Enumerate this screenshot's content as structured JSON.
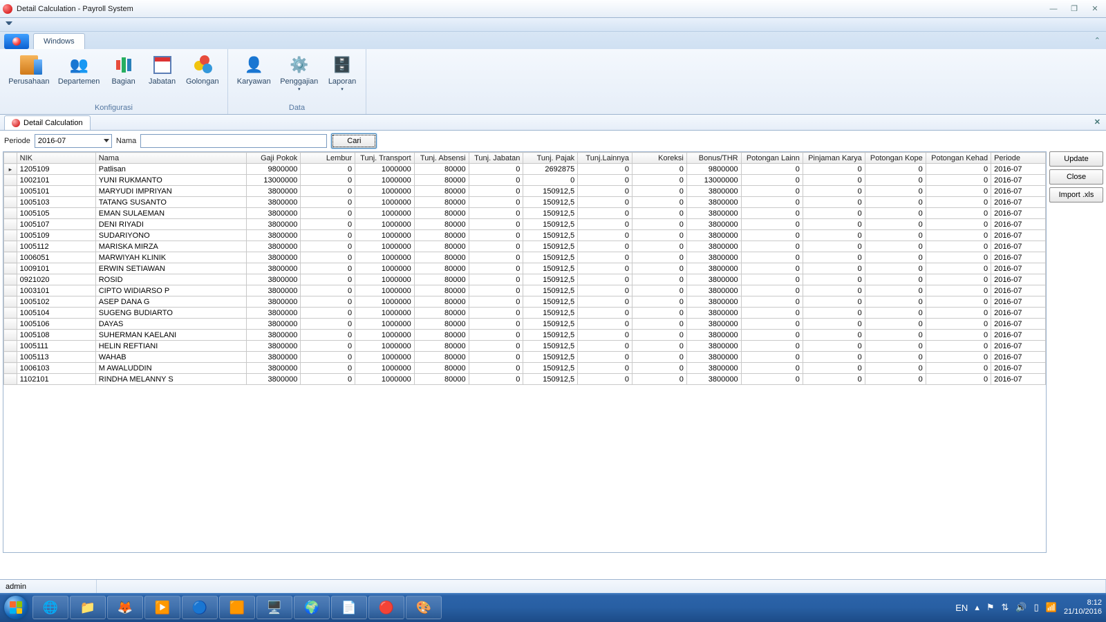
{
  "window": {
    "title": "Detail Calculation - Payroll System"
  },
  "ribbon": {
    "tab_windows": "Windows",
    "group_konfig": "Konfigurasi",
    "group_data": "Data",
    "items": {
      "perusahaan": "Perusahaan",
      "departemen": "Departemen",
      "bagian": "Bagian",
      "jabatan": "Jabatan",
      "golongan": "Golongan",
      "karyawan": "Karyawan",
      "penggajian": "Penggajian",
      "laporan": "Laporan"
    }
  },
  "doctab": {
    "label": "Detail Calculation"
  },
  "filter": {
    "periode_label": "Periode",
    "periode_value": "2016-07",
    "nama_label": "Nama",
    "nama_value": "",
    "cari": "Cari"
  },
  "buttons": {
    "update": "Update",
    "close": "Close",
    "import": "Import .xls"
  },
  "columns": [
    "",
    "NIK",
    "Nama",
    "Gaji Pokok",
    "Lembur",
    "Tunj. Transport",
    "Tunj. Absensi",
    "Tunj. Jabatan",
    "Tunj. Pajak",
    "Tunj.Lainnya",
    "Koreksi",
    "Bonus/THR",
    "Potongan Lainn",
    "Pinjaman Karya",
    "Potongan Kope",
    "Potongan Kehad",
    "Periode"
  ],
  "rows": [
    {
      "sel": true,
      "nik": "1205109",
      "nama": "Patlisan",
      "gp": "9800000",
      "lb": "0",
      "tt": "1000000",
      "ta": "80000",
      "tj": "0",
      "tp": "2692875",
      "tl": "0",
      "kr": "0",
      "bt": "9800000",
      "pl": "0",
      "pk": "0",
      "ko": "0",
      "kh": "0",
      "per": "2016-07"
    },
    {
      "nik": "1002101",
      "nama": "YUNI RUKMANTO",
      "gp": "13000000",
      "lb": "0",
      "tt": "1000000",
      "ta": "80000",
      "tj": "0",
      "tp": "0",
      "tl": "0",
      "kr": "0",
      "bt": "13000000",
      "pl": "0",
      "pk": "0",
      "ko": "0",
      "kh": "0",
      "per": "2016-07"
    },
    {
      "nik": "1005101",
      "nama": "MARYUDI IMPRIYAN",
      "gp": "3800000",
      "lb": "0",
      "tt": "1000000",
      "ta": "80000",
      "tj": "0",
      "tp": "150912,5",
      "tl": "0",
      "kr": "0",
      "bt": "3800000",
      "pl": "0",
      "pk": "0",
      "ko": "0",
      "kh": "0",
      "per": "2016-07"
    },
    {
      "nik": "1005103",
      "nama": "TATANG SUSANTO",
      "gp": "3800000",
      "lb": "0",
      "tt": "1000000",
      "ta": "80000",
      "tj": "0",
      "tp": "150912,5",
      "tl": "0",
      "kr": "0",
      "bt": "3800000",
      "pl": "0",
      "pk": "0",
      "ko": "0",
      "kh": "0",
      "per": "2016-07"
    },
    {
      "nik": "1005105",
      "nama": "EMAN SULAEMAN",
      "gp": "3800000",
      "lb": "0",
      "tt": "1000000",
      "ta": "80000",
      "tj": "0",
      "tp": "150912,5",
      "tl": "0",
      "kr": "0",
      "bt": "3800000",
      "pl": "0",
      "pk": "0",
      "ko": "0",
      "kh": "0",
      "per": "2016-07"
    },
    {
      "nik": "1005107",
      "nama": "DENI RIYADI",
      "gp": "3800000",
      "lb": "0",
      "tt": "1000000",
      "ta": "80000",
      "tj": "0",
      "tp": "150912,5",
      "tl": "0",
      "kr": "0",
      "bt": "3800000",
      "pl": "0",
      "pk": "0",
      "ko": "0",
      "kh": "0",
      "per": "2016-07"
    },
    {
      "nik": "1005109",
      "nama": "SUDARIYONO",
      "gp": "3800000",
      "lb": "0",
      "tt": "1000000",
      "ta": "80000",
      "tj": "0",
      "tp": "150912,5",
      "tl": "0",
      "kr": "0",
      "bt": "3800000",
      "pl": "0",
      "pk": "0",
      "ko": "0",
      "kh": "0",
      "per": "2016-07"
    },
    {
      "nik": "1005112",
      "nama": "MARISKA  MIRZA",
      "gp": "3800000",
      "lb": "0",
      "tt": "1000000",
      "ta": "80000",
      "tj": "0",
      "tp": "150912,5",
      "tl": "0",
      "kr": "0",
      "bt": "3800000",
      "pl": "0",
      "pk": "0",
      "ko": "0",
      "kh": "0",
      "per": "2016-07"
    },
    {
      "nik": "1006051",
      "nama": "MARWIYAH KLINIK",
      "gp": "3800000",
      "lb": "0",
      "tt": "1000000",
      "ta": "80000",
      "tj": "0",
      "tp": "150912,5",
      "tl": "0",
      "kr": "0",
      "bt": "3800000",
      "pl": "0",
      "pk": "0",
      "ko": "0",
      "kh": "0",
      "per": "2016-07"
    },
    {
      "nik": "1009101",
      "nama": "ERWIN SETIAWAN",
      "gp": "3800000",
      "lb": "0",
      "tt": "1000000",
      "ta": "80000",
      "tj": "0",
      "tp": "150912,5",
      "tl": "0",
      "kr": "0",
      "bt": "3800000",
      "pl": "0",
      "pk": "0",
      "ko": "0",
      "kh": "0",
      "per": "2016-07"
    },
    {
      "nik": "0921020",
      "nama": "ROSID",
      "gp": "3800000",
      "lb": "0",
      "tt": "1000000",
      "ta": "80000",
      "tj": "0",
      "tp": "150912,5",
      "tl": "0",
      "kr": "0",
      "bt": "3800000",
      "pl": "0",
      "pk": "0",
      "ko": "0",
      "kh": "0",
      "per": "2016-07"
    },
    {
      "nik": "1003101",
      "nama": "CIPTO WIDIARSO P",
      "gp": "3800000",
      "lb": "0",
      "tt": "1000000",
      "ta": "80000",
      "tj": "0",
      "tp": "150912,5",
      "tl": "0",
      "kr": "0",
      "bt": "3800000",
      "pl": "0",
      "pk": "0",
      "ko": "0",
      "kh": "0",
      "per": "2016-07"
    },
    {
      "nik": "1005102",
      "nama": "ASEP DANA G",
      "gp": "3800000",
      "lb": "0",
      "tt": "1000000",
      "ta": "80000",
      "tj": "0",
      "tp": "150912,5",
      "tl": "0",
      "kr": "0",
      "bt": "3800000",
      "pl": "0",
      "pk": "0",
      "ko": "0",
      "kh": "0",
      "per": "2016-07"
    },
    {
      "nik": "1005104",
      "nama": "SUGENG BUDIARTO",
      "gp": "3800000",
      "lb": "0",
      "tt": "1000000",
      "ta": "80000",
      "tj": "0",
      "tp": "150912,5",
      "tl": "0",
      "kr": "0",
      "bt": "3800000",
      "pl": "0",
      "pk": "0",
      "ko": "0",
      "kh": "0",
      "per": "2016-07"
    },
    {
      "nik": "1005106",
      "nama": "DAYAS",
      "gp": "3800000",
      "lb": "0",
      "tt": "1000000",
      "ta": "80000",
      "tj": "0",
      "tp": "150912,5",
      "tl": "0",
      "kr": "0",
      "bt": "3800000",
      "pl": "0",
      "pk": "0",
      "ko": "0",
      "kh": "0",
      "per": "2016-07"
    },
    {
      "nik": "1005108",
      "nama": "SUHERMAN KAELANI",
      "gp": "3800000",
      "lb": "0",
      "tt": "1000000",
      "ta": "80000",
      "tj": "0",
      "tp": "150912,5",
      "tl": "0",
      "kr": "0",
      "bt": "3800000",
      "pl": "0",
      "pk": "0",
      "ko": "0",
      "kh": "0",
      "per": "2016-07"
    },
    {
      "nik": "1005111",
      "nama": "HELIN REFTIANI",
      "gp": "3800000",
      "lb": "0",
      "tt": "1000000",
      "ta": "80000",
      "tj": "0",
      "tp": "150912,5",
      "tl": "0",
      "kr": "0",
      "bt": "3800000",
      "pl": "0",
      "pk": "0",
      "ko": "0",
      "kh": "0",
      "per": "2016-07"
    },
    {
      "nik": "1005113",
      "nama": "WAHAB",
      "gp": "3800000",
      "lb": "0",
      "tt": "1000000",
      "ta": "80000",
      "tj": "0",
      "tp": "150912,5",
      "tl": "0",
      "kr": "0",
      "bt": "3800000",
      "pl": "0",
      "pk": "0",
      "ko": "0",
      "kh": "0",
      "per": "2016-07"
    },
    {
      "nik": "1006103",
      "nama": "M AWALUDDIN",
      "gp": "3800000",
      "lb": "0",
      "tt": "1000000",
      "ta": "80000",
      "tj": "0",
      "tp": "150912,5",
      "tl": "0",
      "kr": "0",
      "bt": "3800000",
      "pl": "0",
      "pk": "0",
      "ko": "0",
      "kh": "0",
      "per": "2016-07"
    },
    {
      "nik": "1102101",
      "nama": "RINDHA MELANNY S",
      "gp": "3800000",
      "lb": "0",
      "tt": "1000000",
      "ta": "80000",
      "tj": "0",
      "tp": "150912,5",
      "tl": "0",
      "kr": "0",
      "bt": "3800000",
      "pl": "0",
      "pk": "0",
      "ko": "0",
      "kh": "0",
      "per": "2016-07"
    }
  ],
  "status": {
    "user": "admin"
  },
  "tray": {
    "lang": "EN",
    "time": "8:12",
    "date": "21/10/2016"
  }
}
